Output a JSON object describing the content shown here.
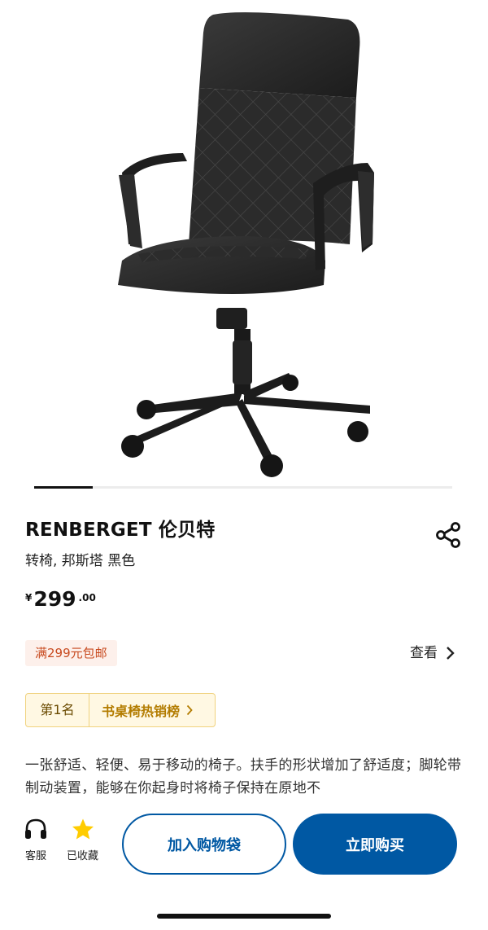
{
  "gallery": {
    "image_name": "chair-product-image",
    "progress": 0.14
  },
  "product": {
    "title": "RENBERGET 伦贝特",
    "subtitle": "转椅, 邦斯塔 黑色",
    "price": {
      "currency": "¥",
      "integer": "299",
      "decimal": ".00"
    },
    "shipping_badge": "满299元包邮",
    "view_label": "查看",
    "ranking": {
      "rank": "第1名",
      "list_name": "书桌椅热销榜"
    },
    "description": "一张舒适、轻便、易于移动的椅子。扶手的形状增加了舒适度；脚轮带制动装置，能够在你起身时将椅子保持在原地不"
  },
  "bottom_bar": {
    "service_label": "客服",
    "favorite_label": "已收藏",
    "add_to_cart_label": "加入购物袋",
    "buy_now_label": "立即购买"
  },
  "colors": {
    "brand_blue": "#0058a3",
    "favorite_star": "#ffcc00",
    "badge_text": "#c84a1f",
    "rank_text": "#b37c00"
  },
  "icons": [
    "share-icon",
    "chevron-right-icon",
    "headset-icon",
    "star-icon"
  ]
}
